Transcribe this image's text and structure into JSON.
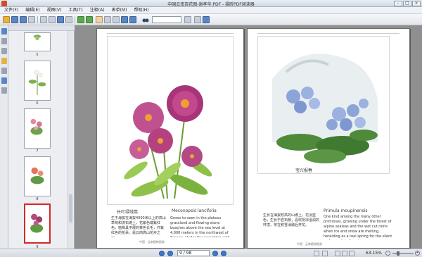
{
  "window": {
    "title": "中国云南百花图-谢孝华.PDF - 福昕PDF阅读器"
  },
  "menu": [
    "文件(F)",
    "编辑(E)",
    "视图(V)",
    "工具(T)",
    "注释(A)",
    "表单(M)",
    "帮助(H)"
  ],
  "thumbnails": [
    {
      "label": "5",
      "active": false
    },
    {
      "label": "6",
      "active": false
    },
    {
      "label": "7",
      "active": false
    },
    {
      "label": "8",
      "active": false
    },
    {
      "label": "9",
      "active": true
    }
  ],
  "left_page": {
    "title_cn": "长叶绿绒蒿",
    "title_en": "Meconopsis lancifolia",
    "body_cn": "生于海拔在海拔4000米以上的高山草甸和流石滩上，花紫色或紫红色，植株具平展的黄色长毛，开紫红色的花朵，是云南高山花卉之一。",
    "body_en": "Grows to seen in the plateau grassland and flowing stone beaches above the sea level at 4,000 meters in the northwest of Yunnan. Under the persisting cold wind and strong ...it stands stout and firm with such deep colourful flowers, which shows the perseverance of its nature.",
    "footer": "中国 · 云南植物图谱"
  },
  "right_page": {
    "title_cn": "宝兴报春",
    "title_en": "Primula moupinensis",
    "body_cn": "生长在海拔较高的山坡上，花淡蓝色，生长于岩石旁，喜欢阴凉湿润的环境，常在积雪消融后开花。",
    "body_en": "One kind among the many other primroses, growing under the forest of alpine azaleas and the wet cut roots when ice and snow are melting, heralding as a real spring for the silent and mountain forests.",
    "footer": "中国 · 云南植物图谱"
  },
  "status": {
    "page_value": "9 / 98",
    "zoom": "63.15%"
  },
  "colors": {
    "active_thumb": "#d12a2a",
    "doc_bg": "#8f8f8f",
    "accent": "#3d79c9"
  }
}
